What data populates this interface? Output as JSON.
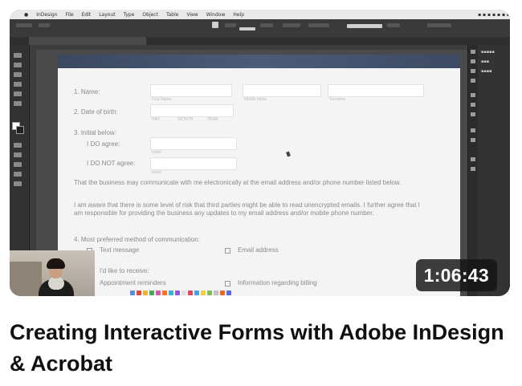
{
  "video": {
    "title": "Creating Interactive Forms with Adobe InDesign & Acrobat",
    "duration": "1:06:43"
  },
  "screen": {
    "menubar_items": [
      "InDesign",
      "File",
      "Edit",
      "Layout",
      "Type",
      "Object",
      "Table",
      "View",
      "Window",
      "Help"
    ],
    "form": {
      "q1": "1.   Name:",
      "q1_captions": [
        "First Name",
        "Middle Initial",
        "Surname"
      ],
      "q2": "2.   Date of birth:",
      "q2_captions": [
        "DAY",
        "MONTH",
        "YEAR"
      ],
      "q3": "3.   Initial below:",
      "q3_agree": "I DO agree:",
      "q3_disagree": "I DO NOT agree:",
      "initials_caption": "Initial",
      "para1": "That the business may communicate with me electronically at the email address and/or phone number listed below.",
      "para2": "I am aware that there is some level of risk that third parties might be able to read unencrypted emails. I further agree that I am responsible for providing the business any updates to my email address and/or mobile phone number.",
      "q4": "4.   Most preferred method of communication:",
      "q4_options": [
        "Text message",
        "Email address"
      ],
      "q5": "I'd like to receive:",
      "q5_options": [
        "Appointment reminders",
        "Information regarding billing"
      ]
    }
  }
}
